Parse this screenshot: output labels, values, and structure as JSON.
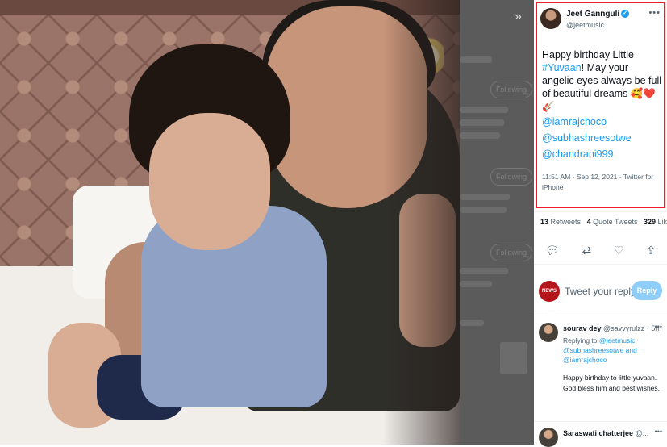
{
  "tweet": {
    "author_name": "Jeet Gannguli",
    "handle": "@jeetmusic",
    "more_icon": "more-options-icon",
    "text_part1": "Happy birthday Little ",
    "hashtag": "#Yuvaan",
    "text_part2": "! May your angelic eyes always be full of beautiful dreams 🥰❤️🎸",
    "mentions": [
      "@iamrajchoco",
      "@subhashreesotwe",
      "@chandrani999"
    ],
    "timestamp": "11:51 AM · Sep 12, 2021 · Twitter for iPhone"
  },
  "stats": {
    "retweets_count": "13",
    "retweets_label": "Retweets",
    "quotes_count": "4",
    "quotes_label": "Quote Tweets",
    "likes_count": "329",
    "likes_label": "Likes"
  },
  "actions": [
    "reply-icon",
    "retweet-icon",
    "like-icon",
    "share-icon"
  ],
  "compose": {
    "avatar_text": "NEWS 18 বাংলা",
    "placeholder": "Tweet your reply",
    "button": "Reply"
  },
  "replies": [
    {
      "name": "sourav dey",
      "handle": "@savvyrulzz · 5h",
      "replying_prefix": "Replying to ",
      "replying_to": "@jeetmusic @subhashreesotwe and @iamrajchoco",
      "text": "Happy birthday to little yuvaan. God bless him and best wishes."
    },
    {
      "name": "Saraswati chatterjee",
      "handle": "@...",
      "replying_prefix": "",
      "replying_to": "",
      "text": ""
    }
  ],
  "sidebar": {
    "collapse_icon": "double-chevron-icon",
    "follow_buttons": [
      "Following",
      "Following",
      "Following"
    ]
  },
  "colors": {
    "accent": "#1d9bf0",
    "highlight_box": "#e8202a"
  }
}
